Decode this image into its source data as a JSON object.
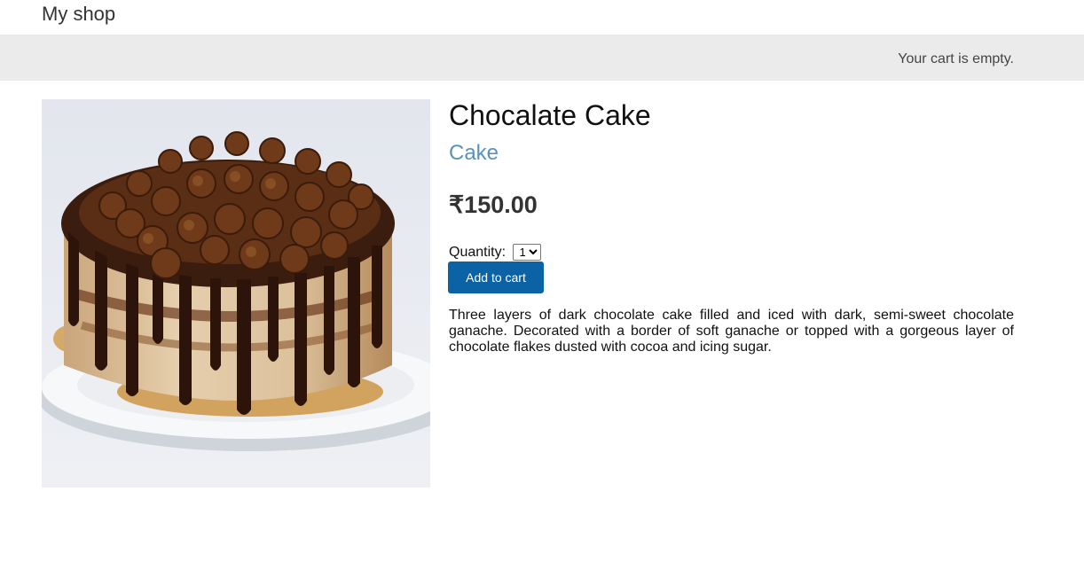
{
  "header": {
    "shop_name": "My shop"
  },
  "cart": {
    "status": "Your cart is empty."
  },
  "product": {
    "name": "Chocalate Cake",
    "category": "Cake",
    "price": "₹150.00",
    "quantity_label": "Quantity:",
    "quantity_selected": "1",
    "add_to_cart_label": "Add to cart",
    "description": "Three layers of dark chocolate cake filled and iced with dark, semi-sweet chocolate ganache. Decorated with a border of soft ganache or topped with a gorgeous layer of chocolate flakes dusted with cocoa and icing sugar."
  },
  "colors": {
    "subheader_bg": "#ebebeb",
    "category_link": "#5993bb",
    "button_bg": "#0b62a4"
  },
  "icons": {
    "product_image": "chocolate-cake-image"
  }
}
